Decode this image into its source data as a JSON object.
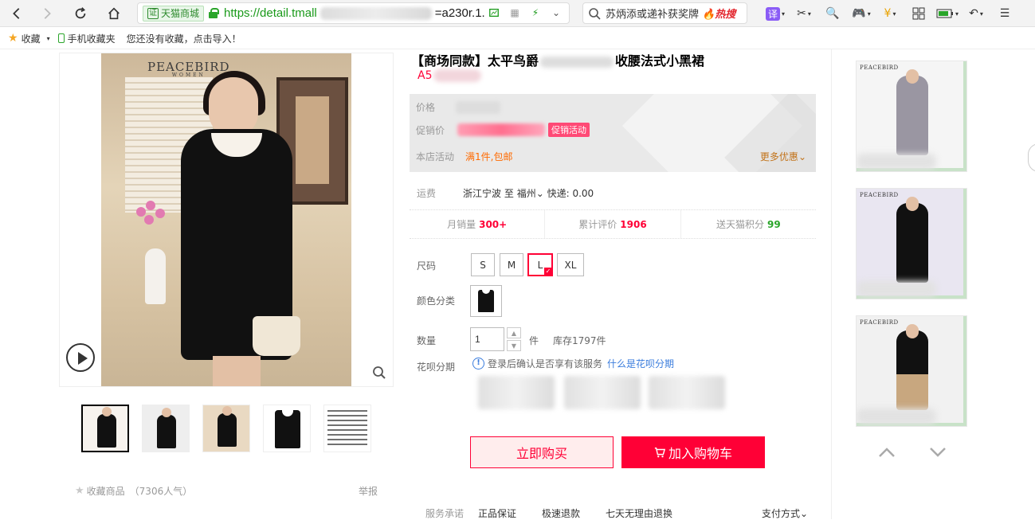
{
  "browser": {
    "site_badge": "天猫商城",
    "url_prefix": "https://detail.tmall",
    "url_suffix": "=a230r.1.",
    "search_text": "苏炳添或递补获奖牌",
    "search_hot": "热搜",
    "translate_label": "译"
  },
  "bookmarks": {
    "favorites": "收藏",
    "mobile_favorites": "手机收藏夹",
    "import_hint": "您还没有收藏，点击导入！"
  },
  "gallery": {
    "logo": "PEACEBIRD",
    "logo_sub": "WOMEN",
    "favorite_label": "收藏商品",
    "favorite_count": "（7306人气）",
    "report_label": "举报"
  },
  "product": {
    "title_left": "【商场同款】太平鸟爵",
    "title_right": "收腰法式小黑裙",
    "subtitle_prefix": "A5",
    "price_label": "价格",
    "promo_label": "促销价",
    "promo_tag": "促销活动",
    "activity_label": "本店活动",
    "activity_value": "满1件,包邮",
    "more_offers": "更多优惠",
    "shipping_label": "运费",
    "shipping_from": "浙江宁波",
    "shipping_to_word": "至",
    "shipping_to": "福州",
    "shipping_fee": "快递: 0.00",
    "stats": [
      {
        "label": "月销量",
        "value": "300+"
      },
      {
        "label": "累计评价",
        "value": "1906"
      },
      {
        "label": "送天猫积分",
        "value": "99"
      }
    ],
    "size_label": "尺码",
    "sizes": [
      "S",
      "M",
      "L",
      "XL"
    ],
    "selected_size": "L",
    "color_label": "颜色分类",
    "qty_label": "数量",
    "qty_value": "1",
    "qty_unit": "件",
    "stock": "库存1797件",
    "huabei_label": "花呗分期",
    "huabei_note": "登录后确认是否享有该服务",
    "huabei_link": "什么是花呗分期",
    "buy_now": "立即购买",
    "add_cart": "加入购物车",
    "service_label": "服务承诺",
    "services": [
      "正品保证",
      "极速退款",
      "七天无理由退换"
    ],
    "pay_way": "支付方式"
  },
  "colors": {
    "accent": "#ff0036",
    "promo": "#ff6a00",
    "link": "#3b7ddd",
    "green": "#2aa52a"
  }
}
